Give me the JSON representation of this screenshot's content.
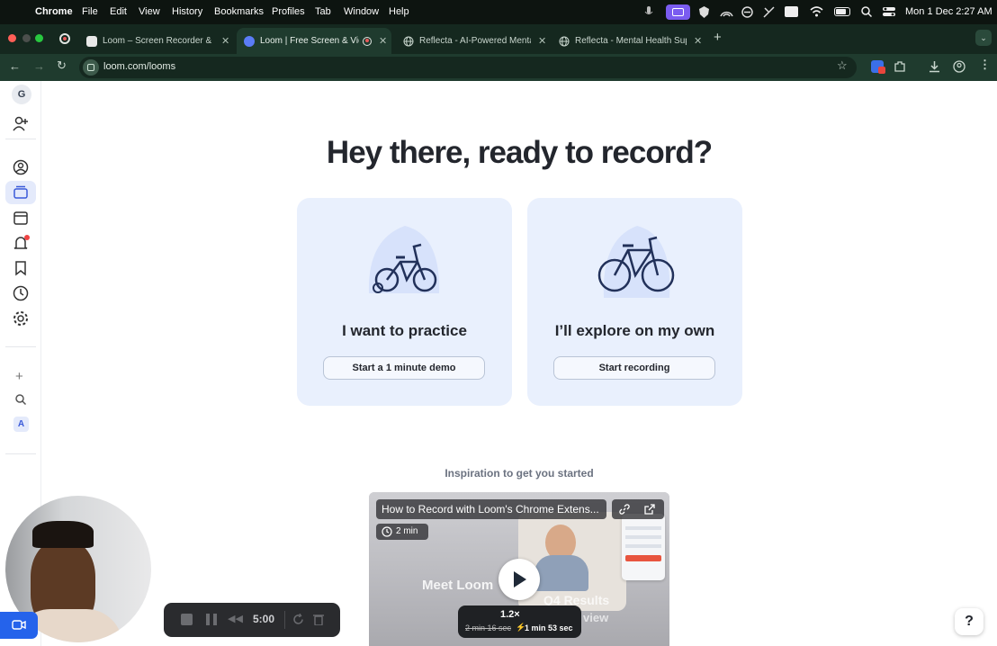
{
  "menubar": {
    "app": "Chrome",
    "items": [
      "File",
      "Edit",
      "View",
      "History",
      "Bookmarks",
      "Profiles",
      "Tab",
      "Window",
      "Help"
    ],
    "clock": "Mon 1 Dec  2:27 AM"
  },
  "tabs": [
    {
      "title": "Loom – Screen Recorder & Sc",
      "active": false
    },
    {
      "title": "Loom | Free Screen & Vide",
      "active": true
    },
    {
      "title": "Reflecta - AI-Powered Menta",
      "active": false
    },
    {
      "title": "Reflecta - Mental Health Sup",
      "active": false
    }
  ],
  "address": {
    "url": "loom.com/looms"
  },
  "rail": {
    "workspace_letter": "G",
    "bottom_letter": "A"
  },
  "main": {
    "headline": "Hey there, ready to record?",
    "cards": [
      {
        "title": "I want to practice",
        "button": "Start a 1 minute demo"
      },
      {
        "title": "I’ll explore on my own",
        "button": "Start recording"
      }
    ],
    "inspiration_label": "Inspiration to get you started"
  },
  "video": {
    "title": "How to Record with Loom's Chrome Extens...",
    "duration": "2 min",
    "overlay_text_left": "Meet Loom",
    "overlay_text_right_1": "Q4 Results",
    "overlay_text_right_2": "view",
    "speed": "1.2×",
    "time_original": "2 min 16 sec",
    "time_fast": "1 min 53 sec"
  },
  "recorder": {
    "timer": "5:00"
  },
  "help": {
    "label": "?"
  },
  "colors": {
    "menubar": "#0d1410",
    "tabstrip": "#15281f",
    "card": "#e9f0fd",
    "headline": "#23262d"
  }
}
